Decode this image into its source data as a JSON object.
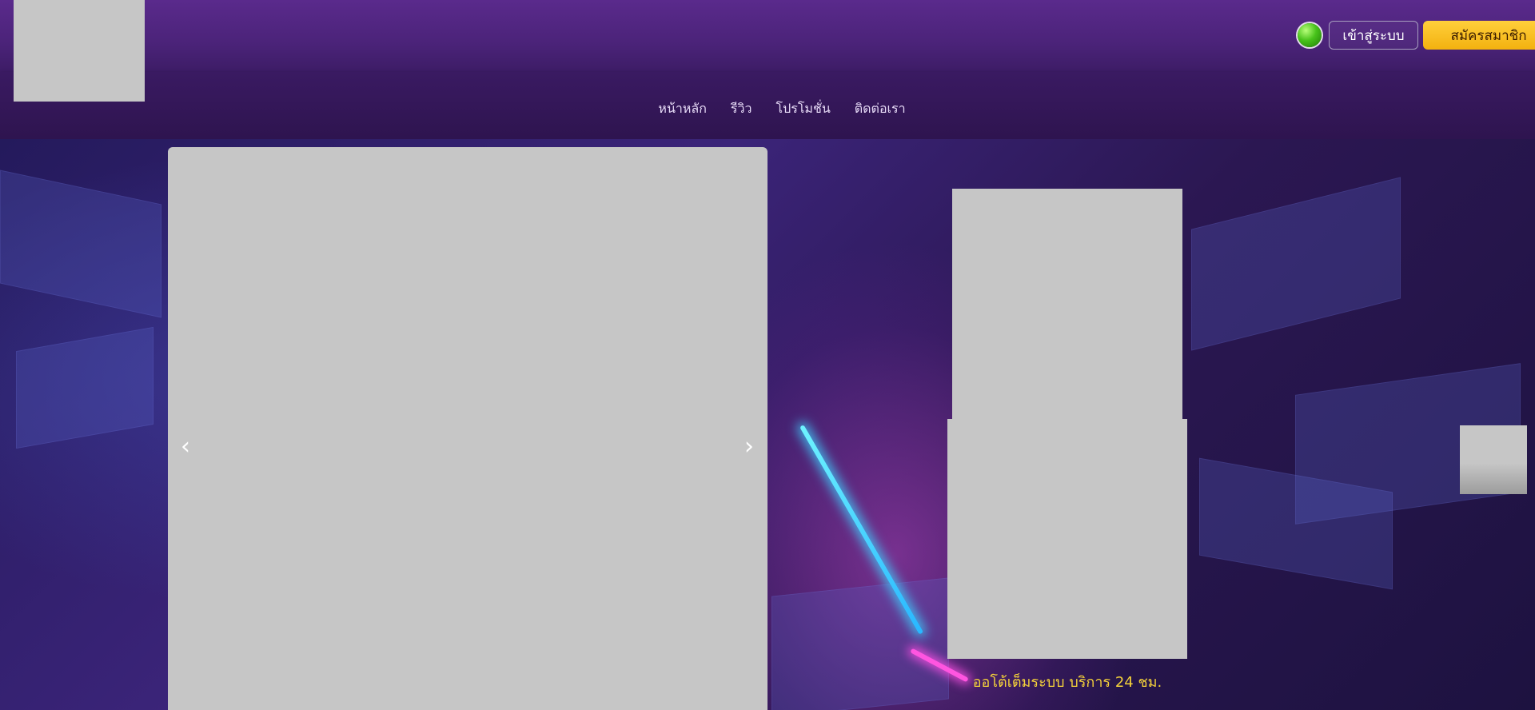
{
  "header": {
    "login_label": "เข้าสู่ระบบ",
    "register_label": "สมัครสมาชิก",
    "status_color": "#3fb81a",
    "register_color": "#f5b90f"
  },
  "nav": {
    "items": [
      {
        "label": "หน้าหลัก"
      },
      {
        "label": "รีวิว"
      },
      {
        "label": "โปรโมชั่น"
      },
      {
        "label": "ติดต่อเรา"
      }
    ]
  },
  "slider": {
    "prev_icon": "chevron-left-icon",
    "next_icon": "chevron-right-icon",
    "prev_glyph": "‹",
    "next_glyph": "›"
  },
  "promo": {
    "tagline": "ออโต้เต็มระบบ บริการ 24 ชม."
  },
  "colors": {
    "header_bg": "#4b2379",
    "accent_yellow": "#f5d23a",
    "placeholder_gray": "#c6c6c6"
  }
}
